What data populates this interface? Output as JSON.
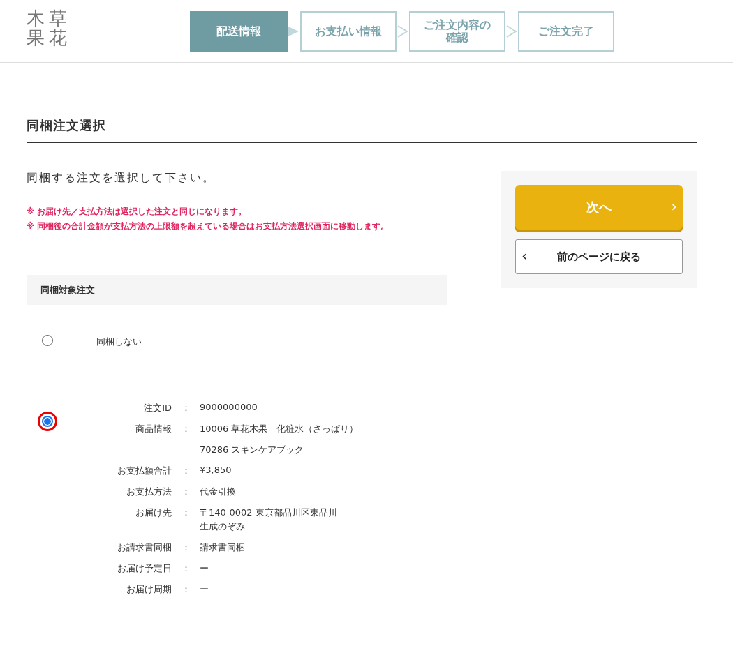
{
  "logo": {
    "chars": [
      "木",
      "草",
      "果",
      "花"
    ]
  },
  "steps": [
    {
      "label": "配送情報",
      "selected": true
    },
    {
      "label": "お支払い情報",
      "selected": false
    },
    {
      "label": "ご注文内容の確認",
      "selected": false
    },
    {
      "label": "ご注文完了",
      "selected": false
    }
  ],
  "heading": "同梱注文選択",
  "instruction": "同梱する注文を選択して下さい。",
  "notes": [
    "※ お届け先／支払方法は選択した注文と同じになります。",
    "※ 同梱後の合計金額が支払方法の上限額を超えている場合はお支払方法選択画面に移動します。"
  ],
  "section_title": "同梱対象注文",
  "options": [
    {
      "selected": false,
      "label": "同梱しない"
    },
    {
      "selected": true,
      "details": [
        {
          "label": "注文ID",
          "colon": "：",
          "kind": "spaced",
          "values": [
            "9000000000"
          ]
        },
        {
          "label": "商品情報",
          "colon": "：",
          "kind": "spaced",
          "values": [
            "10006 草花木果　化粧水（さっぱり）",
            "70286 スキンケアブック"
          ]
        },
        {
          "label": "お支払額合計",
          "colon": "：",
          "kind": "spaced",
          "values": [
            "¥3,850"
          ]
        },
        {
          "label": "お支払方法",
          "colon": "：",
          "kind": "spaced",
          "values": [
            "代金引換"
          ]
        },
        {
          "label": "お届け先",
          "colon": "：",
          "kind": "stacked",
          "values": [
            "〒140-0002 東京都品川区東品川",
            "生成のぞみ"
          ]
        },
        {
          "label": "お請求書同梱",
          "colon": "：",
          "kind": "spaced",
          "values": [
            "請求書同梱"
          ]
        },
        {
          "label": "お届け予定日",
          "colon": "：",
          "kind": "spaced",
          "values": [
            "ー"
          ]
        },
        {
          "label": "お届け周期",
          "colon": "：",
          "kind": "spaced",
          "values": [
            "ー"
          ]
        }
      ]
    }
  ],
  "actions": {
    "next": {
      "label": "次へ",
      "icon": "›"
    },
    "back": {
      "label": "前のページに戻る",
      "icon": "‹"
    }
  }
}
